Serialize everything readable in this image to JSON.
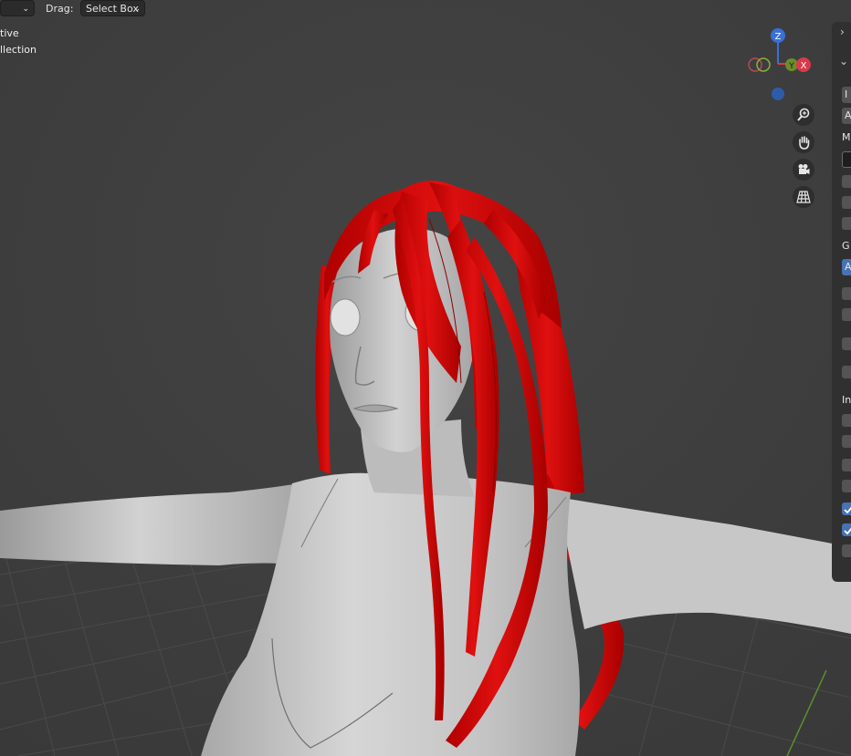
{
  "header": {
    "drag_label": "Drag:",
    "drag_mode": "Select Box"
  },
  "overlay": {
    "line1": "tive",
    "line2": "llection"
  },
  "gizmo": {
    "z": "Z",
    "x": "X",
    "y": "Y"
  },
  "npanel": {
    "field1": "I",
    "field2": "A",
    "label_m": "M",
    "label_g": "G",
    "button_a": "A",
    "label_in": "In"
  },
  "colors": {
    "viewport_bg": "#3d3d3d",
    "hair": "#d80808",
    "skin": "#bdbdbd",
    "accent": "#4772b3"
  }
}
